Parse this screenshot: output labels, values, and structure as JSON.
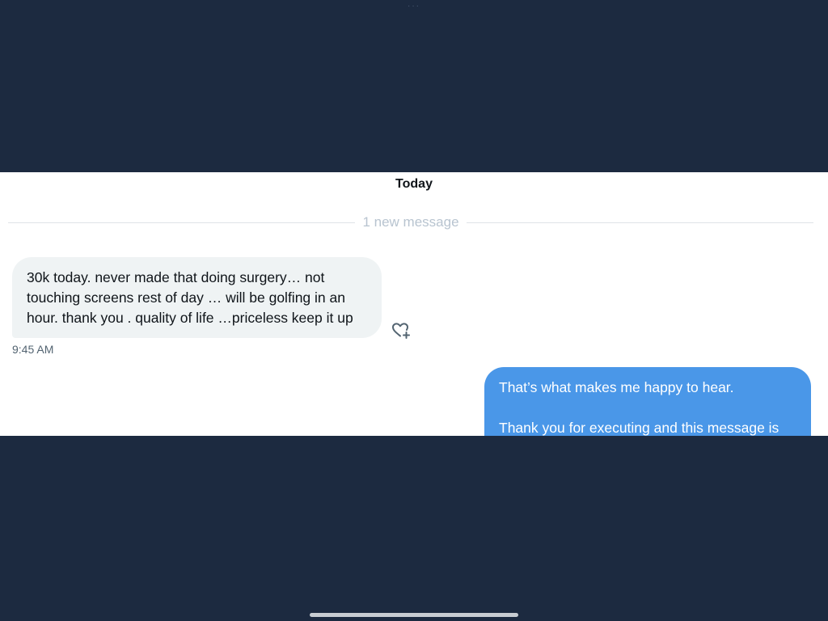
{
  "top_indicator": "···",
  "chat": {
    "date_header": "Today",
    "new_message_divider": "1 new message",
    "incoming": {
      "text": "30k today. never made that doing surgery… not touching screens rest of day … will be golfing in an hour. thank you . quality of life …priceless keep it up",
      "time": "9:45 AM",
      "reaction_icon": "heart-plus-icon"
    },
    "outgoing": {
      "line1": "That’s what makes me happy to hear.",
      "line2": "Thank you for executing and this message is"
    }
  },
  "colors": {
    "background": "#1c2a40",
    "incoming_bubble": "#eff3f4",
    "outgoing_bubble": "#4a97e8",
    "divider_text": "#b8c4d0"
  }
}
